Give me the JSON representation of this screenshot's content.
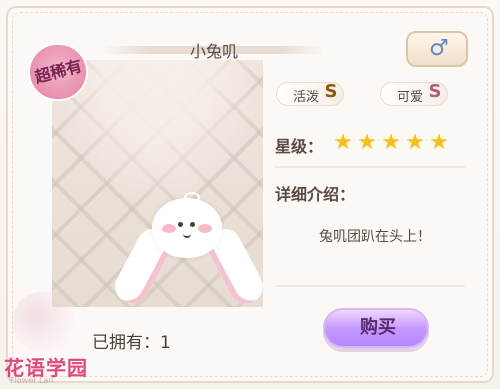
{
  "title": "小兔叽",
  "gender_icon": "male-symbol",
  "rarity_badge": "超稀有",
  "tags": [
    {
      "label": "活泼",
      "grade": "S"
    },
    {
      "label": "可爱",
      "grade": "S"
    }
  ],
  "star_rating": {
    "label": "星级：",
    "value": 5,
    "max": 5
  },
  "details": {
    "label": "详细介绍：",
    "text": "兔叽团趴在头上！"
  },
  "owned": {
    "label": "已拥有：1"
  },
  "buy_button": {
    "label": "购买"
  },
  "watermark": {
    "main": "花语学园",
    "sub": "Flower Lan"
  },
  "colors": {
    "accent_purple": "#c59aff",
    "rarity_pink": "#e990b0",
    "star_gold": "#f3c21a",
    "text_brown": "#5a4a44"
  }
}
